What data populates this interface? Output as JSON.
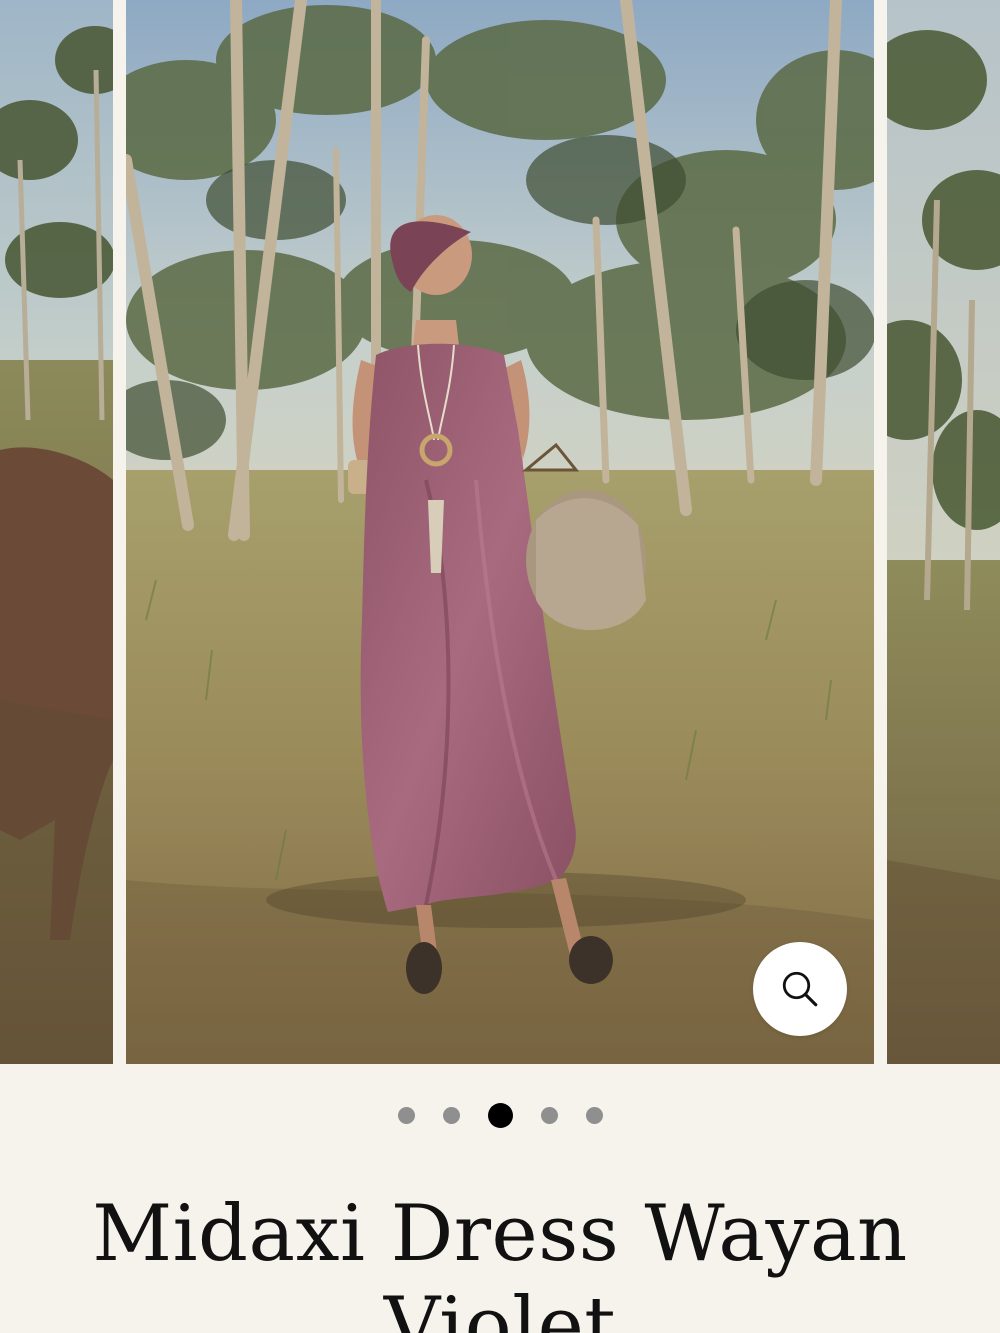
{
  "gallery": {
    "slides": [
      {
        "label": "Previous product photo (dog in palm grove)"
      },
      {
        "label": "Woman in violet midaxi dress in palm grove"
      },
      {
        "label": "Next product photo (palm grove)"
      }
    ],
    "zoom_icon": "search-icon",
    "pagination": {
      "count": 5,
      "active_index": 2
    }
  },
  "product": {
    "title": "Midaxi Dress Wayan Violet"
  },
  "colors": {
    "background": "#f6f3ec",
    "dress": "#9b5f72",
    "dot_active": "#000000",
    "dot_inactive": "#8f8f8f"
  }
}
